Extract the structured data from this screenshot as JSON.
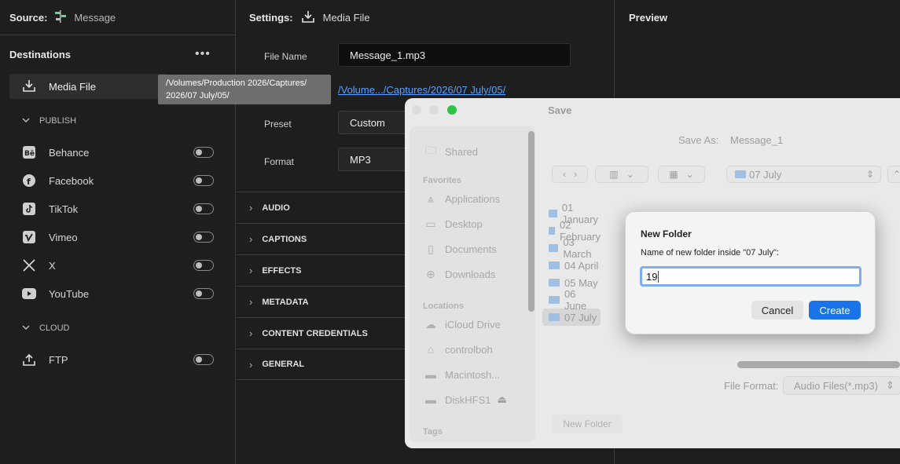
{
  "source": {
    "label": "Source:",
    "value": "Message"
  },
  "destinations": {
    "title": "Destinations",
    "more": "•••",
    "media_file": "Media File",
    "publish_label": "PUBLISH",
    "publish": [
      {
        "label": "Behance",
        "icon": "behance-icon"
      },
      {
        "label": "Facebook",
        "icon": "facebook-icon"
      },
      {
        "label": "TikTok",
        "icon": "tiktok-icon"
      },
      {
        "label": "Vimeo",
        "icon": "vimeo-icon"
      },
      {
        "label": "X",
        "icon": "x-icon"
      },
      {
        "label": "YouTube",
        "icon": "youtube-icon"
      }
    ],
    "cloud_label": "CLOUD",
    "cloud": [
      {
        "label": "FTP",
        "icon": "upload-icon"
      }
    ]
  },
  "tooltip": {
    "line1": "/Volumes/Production 2026/Captures/",
    "line2": "2026/07 July/05/"
  },
  "settings": {
    "label": "Settings:",
    "value": "Media File",
    "file_name_label": "File Name",
    "file_name": "Message_1.mp3",
    "location": "/Volume.../Captures/2026/07 July/05/",
    "preset_label": "Preset",
    "preset": "Custom",
    "format_label": "Format",
    "format": "MP3",
    "sections": [
      "AUDIO",
      "CAPTIONS",
      "EFFECTS",
      "METADATA",
      "CONTENT CREDENTIALS",
      "GENERAL"
    ]
  },
  "preview": {
    "title": "Preview"
  },
  "save_dialog": {
    "title": "Save",
    "save_as_label": "Save As:",
    "save_as": "Message_1",
    "location": "07 July",
    "sidebar": {
      "shared": "Shared",
      "favorites": "Favorites",
      "fav_items": [
        "Applications",
        "Desktop",
        "Documents",
        "Downloads"
      ],
      "locations": "Locations",
      "loc_items": [
        "iCloud Drive",
        "controlboh",
        "Macintosh...",
        "DiskHFS1"
      ],
      "tags": "Tags"
    },
    "folders": [
      "01 January",
      "02 February",
      "03 March",
      "04 April",
      "05 May",
      "06 June",
      "07 July"
    ],
    "selected_folder_index": 6,
    "file_format_label": "File Format:",
    "file_format": "Audio Files(*.mp3)",
    "new_folder_button": "New Folder"
  },
  "new_folder_dialog": {
    "title": "New Folder",
    "subtitle": "Name of new folder inside \"07 July\":",
    "value": "19",
    "cancel": "Cancel",
    "create": "Create"
  }
}
